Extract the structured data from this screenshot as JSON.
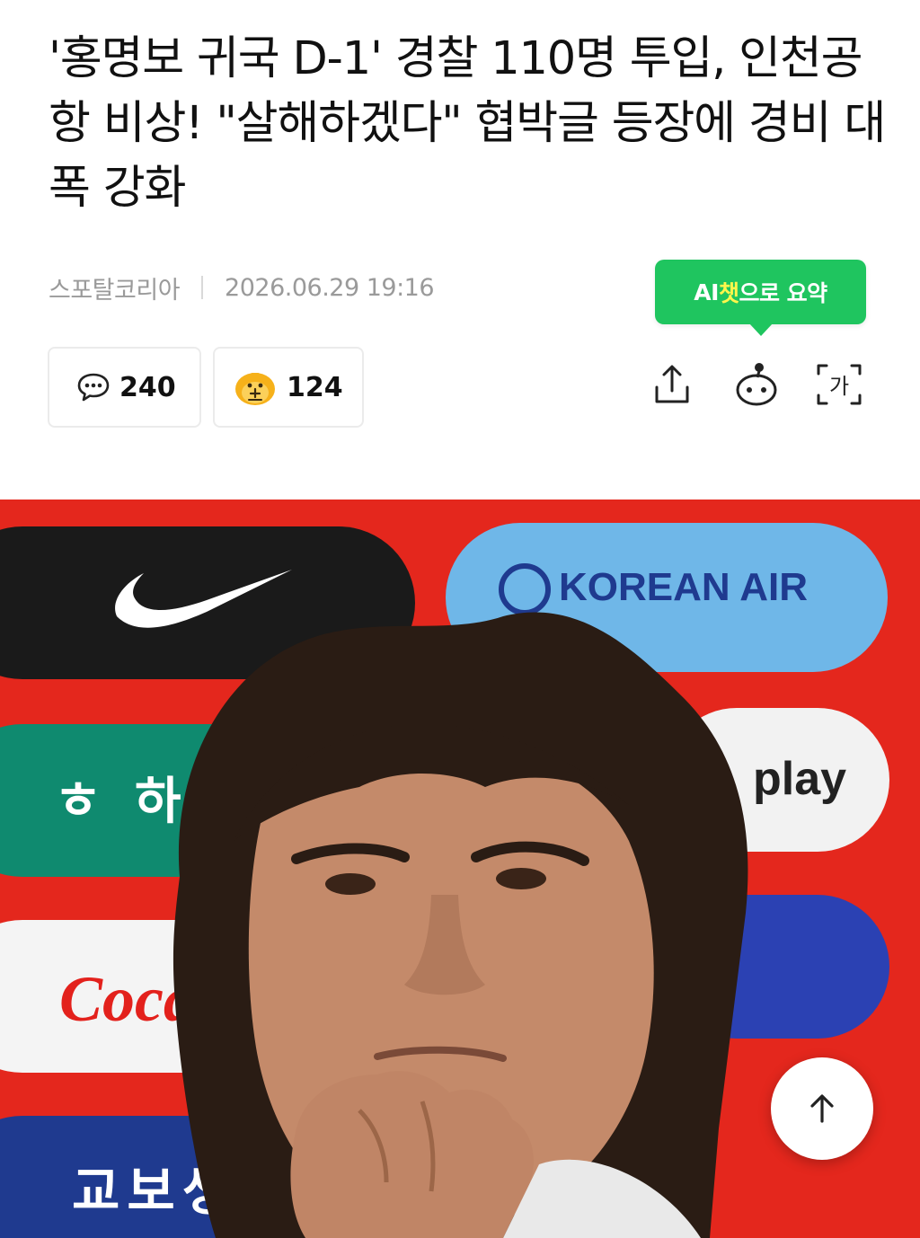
{
  "article": {
    "headline": "'홍명보 귀국 D-1' 경찰 110명 투입, 인천공항 비상! \"살해하겠다\" 협박글 등장에 경비 대폭 강화",
    "source": "스포탈코리아",
    "datetime": "2026.06.29 19:16"
  },
  "ai_summary": {
    "prefix": "AI",
    "highlight": "챗",
    "suffix": "으로 요약"
  },
  "counts": {
    "comments": "240",
    "reactions": "124"
  },
  "toolbar": {
    "share_icon": "share-icon",
    "bot_icon": "bot-icon",
    "font_size_icon": "font-size-icon",
    "font_size_glyph": "가"
  },
  "photo": {
    "sponsor_korean_air": "KOREAN AIR",
    "sponsor_play": "play",
    "sponsor_hana": "하",
    "sponsor_coca_cola": "Coca",
    "sponsor_kyobo": "교보생",
    "colors": {
      "backdrop_red": "#e8281f",
      "korean_air_blue": "#6fb7e8",
      "nike_black": "#1a1a1a",
      "hana_green": "#0f8a6f",
      "kyobo_navy": "#1f3a8f"
    }
  },
  "scroll_top": {
    "icon": "arrow-up-icon"
  }
}
